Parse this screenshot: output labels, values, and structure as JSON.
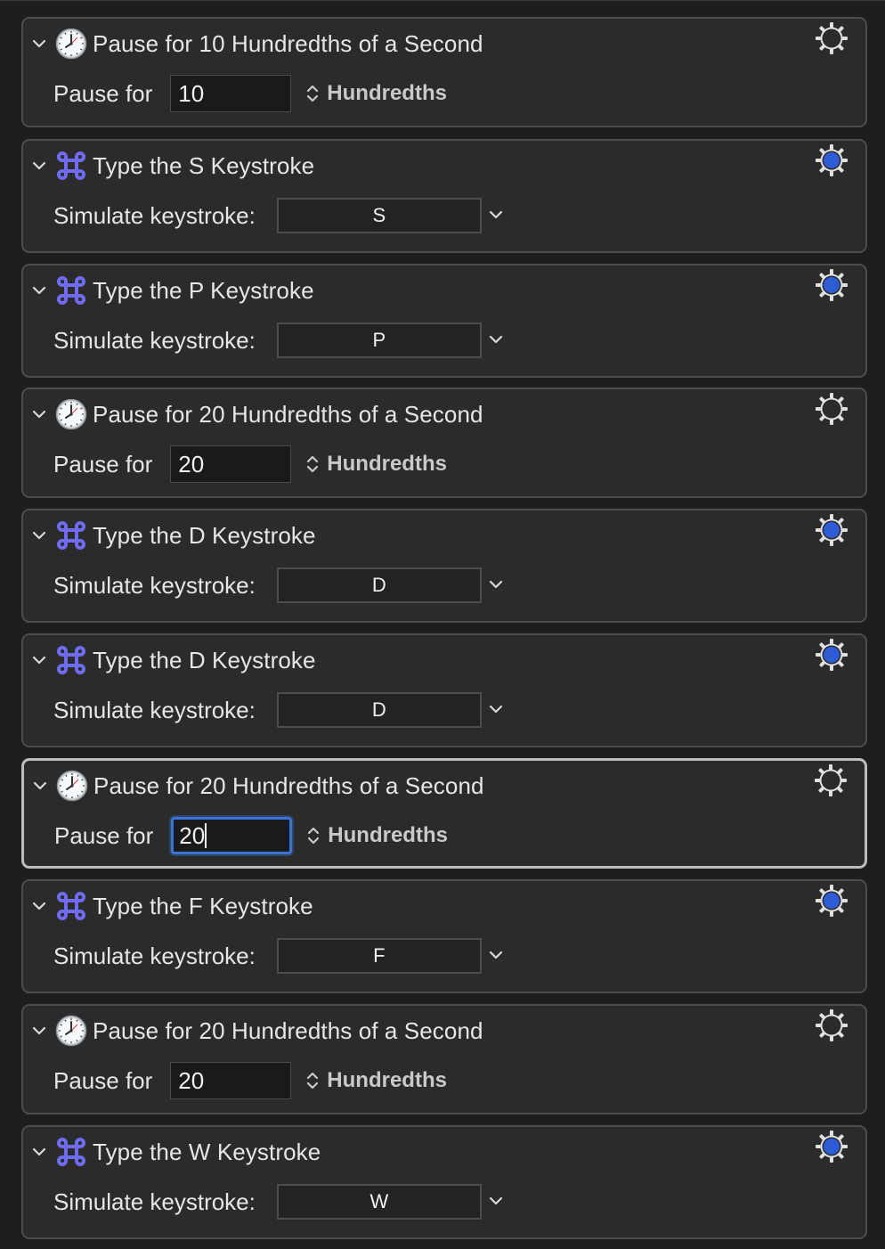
{
  "colors": {
    "panel_bg": "#2b2b2b",
    "page_bg": "#1e1e1e",
    "keystroke_icon": "#6f6cf0",
    "gear_enabled_fill": "#2e5bd6",
    "focus_ring": "#3a73d6"
  },
  "actions": [
    {
      "kind": "pause",
      "title": "Pause for 10 Hundredths of a Second",
      "label": "Pause for",
      "value": "10",
      "unit": "Hundredths",
      "icon": "clock-icon",
      "gear": "gear-icon",
      "selected": false
    },
    {
      "kind": "keystroke",
      "title": "Type the S Keystroke",
      "label": "Simulate keystroke:",
      "key": "S",
      "icon": "command-icon",
      "gear": "gear-enabled-icon",
      "selected": false
    },
    {
      "kind": "keystroke",
      "title": "Type the P Keystroke",
      "label": "Simulate keystroke:",
      "key": "P",
      "icon": "command-icon",
      "gear": "gear-enabled-icon",
      "selected": false
    },
    {
      "kind": "pause",
      "title": "Pause for 20 Hundredths of a Second",
      "label": "Pause for",
      "value": "20",
      "unit": "Hundredths",
      "icon": "clock-icon",
      "gear": "gear-icon",
      "selected": false
    },
    {
      "kind": "keystroke",
      "title": "Type the D Keystroke",
      "label": "Simulate keystroke:",
      "key": "D",
      "icon": "command-icon",
      "gear": "gear-enabled-icon",
      "selected": false
    },
    {
      "kind": "keystroke",
      "title": "Type the D Keystroke",
      "label": "Simulate keystroke:",
      "key": "D",
      "icon": "command-icon",
      "gear": "gear-enabled-icon",
      "selected": false
    },
    {
      "kind": "pause",
      "title": "Pause for 20 Hundredths of a Second",
      "label": "Pause for",
      "value": "20",
      "unit": "Hundredths",
      "icon": "clock-icon",
      "gear": "gear-icon",
      "selected": true
    },
    {
      "kind": "keystroke",
      "title": "Type the F Keystroke",
      "label": "Simulate keystroke:",
      "key": "F",
      "icon": "command-icon",
      "gear": "gear-enabled-icon",
      "selected": false
    },
    {
      "kind": "pause",
      "title": "Pause for 20 Hundredths of a Second",
      "label": "Pause for",
      "value": "20",
      "unit": "Hundredths",
      "icon": "clock-icon",
      "gear": "gear-icon",
      "selected": false
    },
    {
      "kind": "keystroke",
      "title": "Type the W Keystroke",
      "label": "Simulate keystroke:",
      "key": "W",
      "icon": "command-icon",
      "gear": "gear-enabled-icon",
      "selected": false
    }
  ]
}
